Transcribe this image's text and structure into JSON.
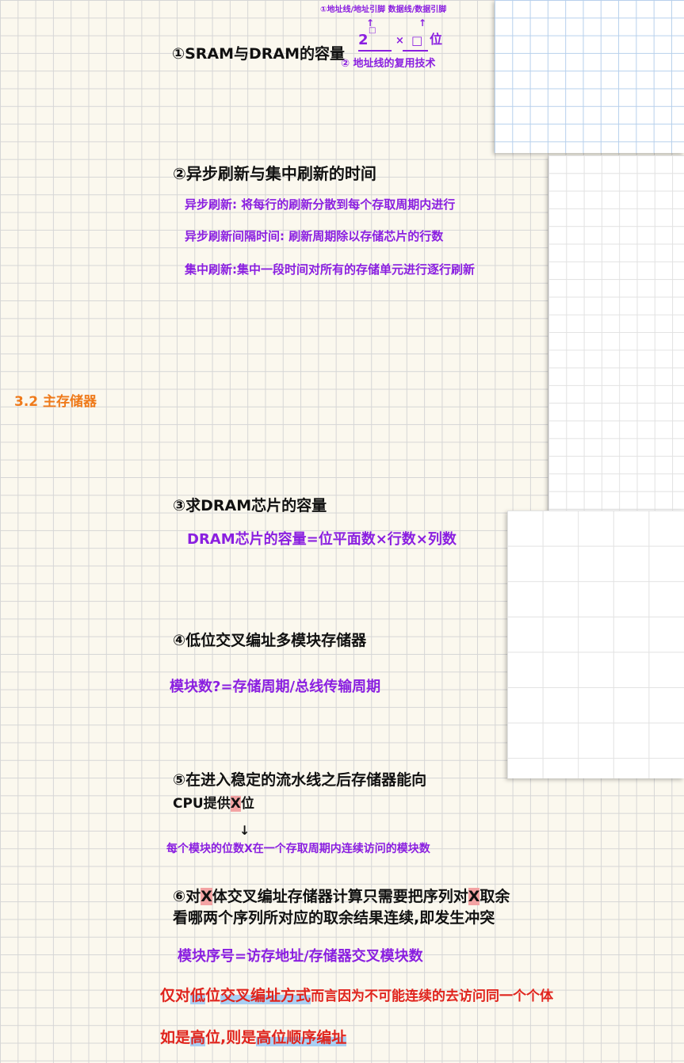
{
  "section": {
    "title": "3.2 主存储器"
  },
  "items": {
    "s1": {
      "heading": "①SRAM与DRAM的容量",
      "formula_base": "2",
      "formula_exp": "□",
      "formula_times": "×",
      "formula_box": "□",
      "formula_unit": "位",
      "note_top": "①地址线/地址引脚 数据线/数据引脚",
      "note_bottom": "② 地址线的复用技术"
    },
    "s2": {
      "heading": "②异步刷新与集中刷新的时间",
      "lines": [
        "异步刷新: 将每行的刷新分散到每个存取周期内进行",
        "异步刷新间隔时间: 刷新周期除以存储芯片的行数",
        "集中刷新:集中一段时间对所有的存储单元进行逐行刷新"
      ]
    },
    "s3": {
      "heading": "③求DRAM芯片的容量",
      "formula": "DRAM芯片的容量=位平面数×行数×列数"
    },
    "s4": {
      "heading": "④低位交叉编址多模块存储器",
      "formula": "模块数?=存储周期/总线传输周期"
    },
    "s5": {
      "heading_line1": "⑤在进入稳定的流水线之后存储器能向",
      "heading_line2_pre": "CPU提供",
      "heading_line2_mark": "X",
      "heading_line2_post": "位",
      "arrow": "↓",
      "note": "每个模块的位数X在一个存取周期内连续访问的模块数"
    },
    "s6": {
      "line1_pre": "⑥对",
      "line1_mark": "X",
      "line1_mid": "体交叉编址存储器计算只需要把序列对",
      "line1_mark2": "X",
      "line1_post": "取余",
      "line2": "看哪两个序列所对应的取余结果连续,即发生冲突",
      "formula": "模块序号=访存地址/存储器交叉模块数"
    },
    "red_notes": {
      "line1_a": "仅对",
      "line1_hl1": "低",
      "line1_b": "位",
      "line1_hl2": "交叉编址方式",
      "line1_c": "而言因为不可能连续的去访问同一个个体",
      "line2_a": "如是",
      "line2_hl1": "高",
      "line2_b": "位,则是",
      "line2_hl2": "高位顺序编址"
    }
  }
}
